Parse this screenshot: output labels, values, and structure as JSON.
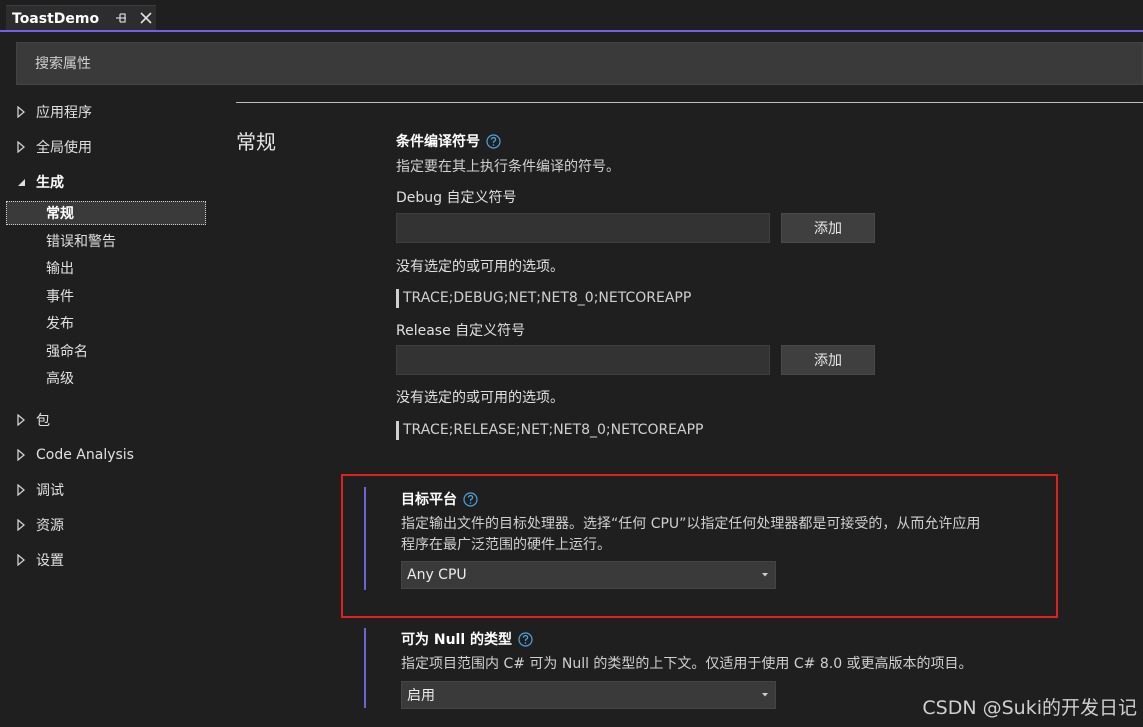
{
  "tab": {
    "title": "ToastDemo"
  },
  "search": {
    "placeholder": "搜索属性"
  },
  "tree": {
    "items": [
      {
        "label": "应用程序"
      },
      {
        "label": "全局使用"
      },
      {
        "label": "生成"
      },
      {
        "label": "包"
      },
      {
        "label": "Code Analysis"
      },
      {
        "label": "调试"
      },
      {
        "label": "资源"
      },
      {
        "label": "设置"
      }
    ],
    "build_children": [
      {
        "label": "常规"
      },
      {
        "label": "错误和警告"
      },
      {
        "label": "输出"
      },
      {
        "label": "事件"
      },
      {
        "label": "发布"
      },
      {
        "label": "强命名"
      },
      {
        "label": "高级"
      }
    ]
  },
  "content": {
    "section_title": "常规",
    "conditional_symbols": {
      "title": "条件编译符号",
      "description": "指定要在其上执行条件编译的符号。",
      "debug_label": "Debug 自定义符号",
      "debug_add": "添加",
      "debug_empty": "没有选定的或可用的选项。",
      "debug_implicit": "TRACE;DEBUG;NET;NET8_0;NETCOREAPP",
      "release_label": "Release 自定义符号",
      "release_add": "添加",
      "release_empty": "没有选定的或可用的选项。",
      "release_implicit": "TRACE;RELEASE;NET;NET8_0;NETCOREAPP"
    },
    "platform_target": {
      "title": "目标平台",
      "description_line1": "指定输出文件的目标处理器。选择“任何 CPU”以指定任何处理器都是可接受的，从而允许应用",
      "description_line2": "程序在最广泛范围的硬件上运行。",
      "value": "Any CPU"
    },
    "nullable": {
      "title": "可为 Null 的类型",
      "description": "指定项目范围内 C# 可为 Null 的类型的上下文。仅适用于使用 C# 8.0 或更高版本的项目。",
      "value": "启用"
    }
  },
  "watermark": "CSDN @Suki的开发日记",
  "colors": {
    "accent": "#7160e8",
    "highlight": "#e02020",
    "help_icon": "#4fa3e0"
  }
}
